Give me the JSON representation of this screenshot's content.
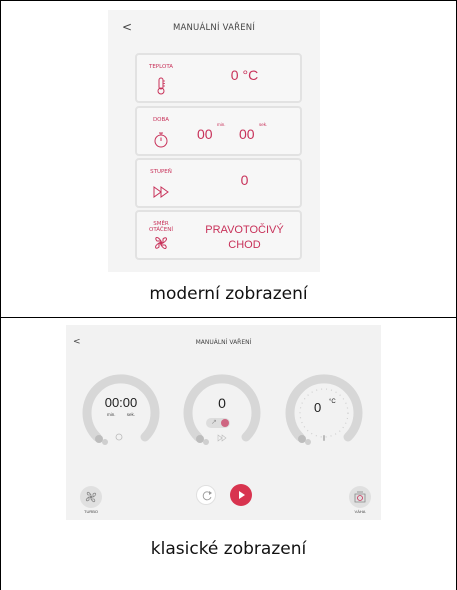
{
  "modern": {
    "title": "MANUÁLNÍ VAŘENÍ",
    "back_symbol": "<",
    "cards": {
      "temperature": {
        "label": "TEPLOTA",
        "value": "0 °C"
      },
      "time": {
        "label": "DOBA",
        "minutes": "00",
        "minutes_unit": "min.",
        "seconds": "00",
        "seconds_unit": "sek."
      },
      "speed": {
        "label": "STUPEŇ",
        "value": "0"
      },
      "rotation": {
        "label": "SMĚR OTÁČENÍ",
        "value_line1": "PRAVOTOČIVÝ",
        "value_line2": "CHOD"
      }
    },
    "caption": "moderní zobrazení"
  },
  "classic": {
    "title": "MANUÁLNÍ VAŘENÍ",
    "back_symbol": "<",
    "time_dial": {
      "value": "00:00",
      "unit_min": "min.",
      "unit_sec": "sek."
    },
    "speed_dial": {
      "value": "0"
    },
    "temp_dial": {
      "value": "0",
      "unit": "°C"
    },
    "turbo_label": "TURBO",
    "scale_label": "VÁHA",
    "caption": "klasické zobrazení"
  },
  "colors": {
    "accent": "#c8325a",
    "play": "#d8344f",
    "panel_bg": "#f4f4f4"
  }
}
